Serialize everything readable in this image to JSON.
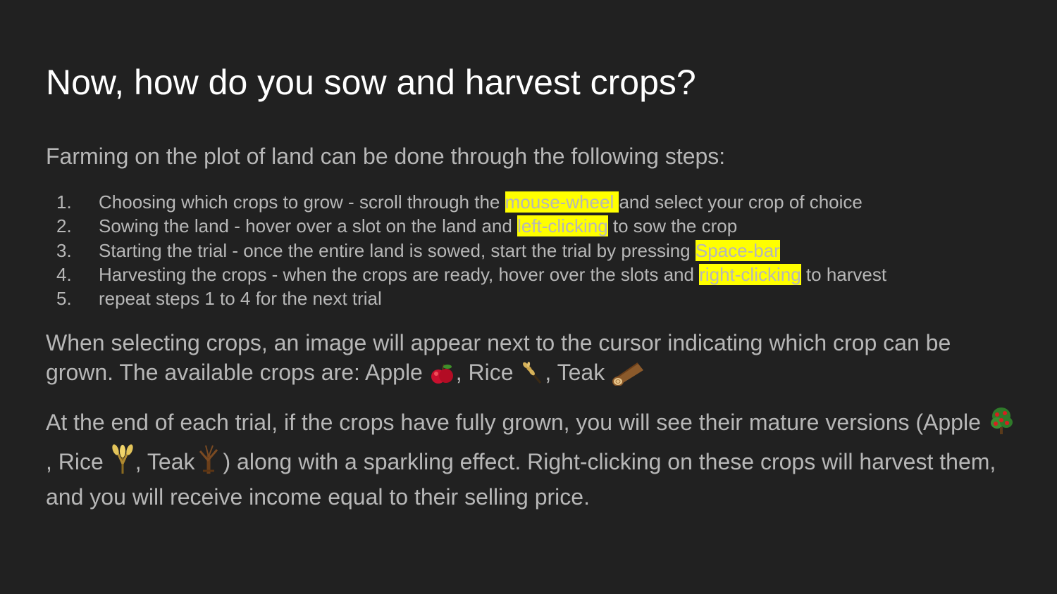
{
  "slide": {
    "title": "Now, how do you sow and harvest crops?",
    "intro": "Farming on the plot of land can be done through the following steps:"
  },
  "steps": [
    {
      "num": "1.",
      "before": "Choosing which crops to grow - scroll through the ",
      "highlight": "mouse-wheel ",
      "after": "and select your crop of choice"
    },
    {
      "num": "2.",
      "before": "Sowing the land - hover over a slot on the land and ",
      "highlight": "left-clicking",
      "after": " to sow the crop"
    },
    {
      "num": "3.",
      "before": "Starting the trial - once the entire land is sowed, start the trial by pressing ",
      "highlight": "Space-bar",
      "after": ""
    },
    {
      "num": "4.",
      "before": "Harvesting the crops - when the crops are ready, hover over the slots and ",
      "highlight": "right-clicking",
      "after": " to harvest"
    },
    {
      "num": "5.",
      "before": "repeat steps 1 to 4 for the next trial",
      "highlight": "",
      "after": ""
    }
  ],
  "para1": {
    "text": "When selecting crops, an image will appear next to the cursor indicating which crop can be grown. The available crops are: ",
    "apple": "Apple ",
    "rice": ", Rice ",
    "teak": ", Teak "
  },
  "para2": {
    "text": "At the end of each trial, if the crops have fully grown, you will see their mature versions (",
    "apple": "Apple ",
    "rice": ", Rice ",
    "teak": ", Teak",
    "rest": ") along with a sparkling effect. Right-clicking on these crops will harvest them, and you will receive income equal to their selling price."
  },
  "colors": {
    "background": "#212121",
    "title": "#ffffff",
    "body_text": "#b7b7b7",
    "highlight": "#ffff00"
  },
  "icons": [
    "apple-icon",
    "rice-icon",
    "teak-log-icon",
    "mature-apple-icon",
    "mature-rice-icon",
    "mature-teak-icon"
  ]
}
